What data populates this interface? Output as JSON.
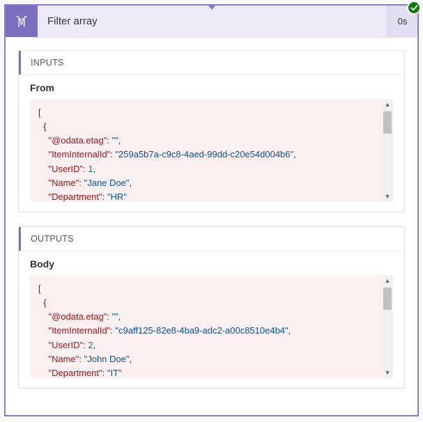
{
  "header": {
    "title": "Filter array",
    "duration": "0s"
  },
  "inputs": {
    "label": "INPUTS",
    "section": "From",
    "lines": [
      {
        "indent": 0,
        "segs": [
          {
            "t": "[",
            "c": "punc"
          }
        ]
      },
      {
        "indent": 1,
        "segs": [
          {
            "t": "{",
            "c": "punc"
          }
        ]
      },
      {
        "indent": 2,
        "segs": [
          {
            "t": "\"@odata.etag\"",
            "c": "key"
          },
          {
            "t": ": ",
            "c": "punc"
          },
          {
            "t": "\"\"",
            "c": "str"
          },
          {
            "t": ",",
            "c": "punc"
          }
        ]
      },
      {
        "indent": 2,
        "segs": [
          {
            "t": "\"ItemInternalId\"",
            "c": "key"
          },
          {
            "t": ": ",
            "c": "punc"
          },
          {
            "t": "\"259a5b7a-c9c8-4aed-99dd-c20e54d004b6\"",
            "c": "str"
          },
          {
            "t": ",",
            "c": "punc"
          }
        ]
      },
      {
        "indent": 2,
        "segs": [
          {
            "t": "\"UserID\"",
            "c": "key"
          },
          {
            "t": ": ",
            "c": "punc"
          },
          {
            "t": "1",
            "c": "num"
          },
          {
            "t": ",",
            "c": "punc"
          }
        ]
      },
      {
        "indent": 2,
        "segs": [
          {
            "t": "\"Name\"",
            "c": "key"
          },
          {
            "t": ": ",
            "c": "punc"
          },
          {
            "t": "\"Jane Doe\"",
            "c": "str"
          },
          {
            "t": ",",
            "c": "punc"
          }
        ]
      },
      {
        "indent": 2,
        "segs": [
          {
            "t": "\"Department\"",
            "c": "key"
          },
          {
            "t": ": ",
            "c": "punc"
          },
          {
            "t": "\"HR\"",
            "c": "str"
          }
        ]
      }
    ]
  },
  "outputs": {
    "label": "OUTPUTS",
    "section": "Body",
    "lines": [
      {
        "indent": 0,
        "segs": [
          {
            "t": "[",
            "c": "punc"
          }
        ]
      },
      {
        "indent": 1,
        "segs": [
          {
            "t": "{",
            "c": "punc"
          }
        ]
      },
      {
        "indent": 2,
        "segs": [
          {
            "t": "\"@odata.etag\"",
            "c": "key"
          },
          {
            "t": ": ",
            "c": "punc"
          },
          {
            "t": "\"\"",
            "c": "str"
          },
          {
            "t": ",",
            "c": "punc"
          }
        ]
      },
      {
        "indent": 2,
        "segs": [
          {
            "t": "\"ItemInternalId\"",
            "c": "key"
          },
          {
            "t": ": ",
            "c": "punc"
          },
          {
            "t": "\"c9aff125-82e8-4ba9-adc2-a00c8510e4b4\"",
            "c": "str"
          },
          {
            "t": ",",
            "c": "punc"
          }
        ]
      },
      {
        "indent": 2,
        "segs": [
          {
            "t": "\"UserID\"",
            "c": "key"
          },
          {
            "t": ": ",
            "c": "punc"
          },
          {
            "t": "2",
            "c": "num"
          },
          {
            "t": ",",
            "c": "punc"
          }
        ]
      },
      {
        "indent": 2,
        "segs": [
          {
            "t": "\"Name\"",
            "c": "key"
          },
          {
            "t": ": ",
            "c": "punc"
          },
          {
            "t": "\"John Doe\"",
            "c": "str"
          },
          {
            "t": ",",
            "c": "punc"
          }
        ]
      },
      {
        "indent": 2,
        "segs": [
          {
            "t": "\"Department\"",
            "c": "key"
          },
          {
            "t": ": ",
            "c": "punc"
          },
          {
            "t": "\"IT\"",
            "c": "str"
          }
        ]
      }
    ]
  }
}
